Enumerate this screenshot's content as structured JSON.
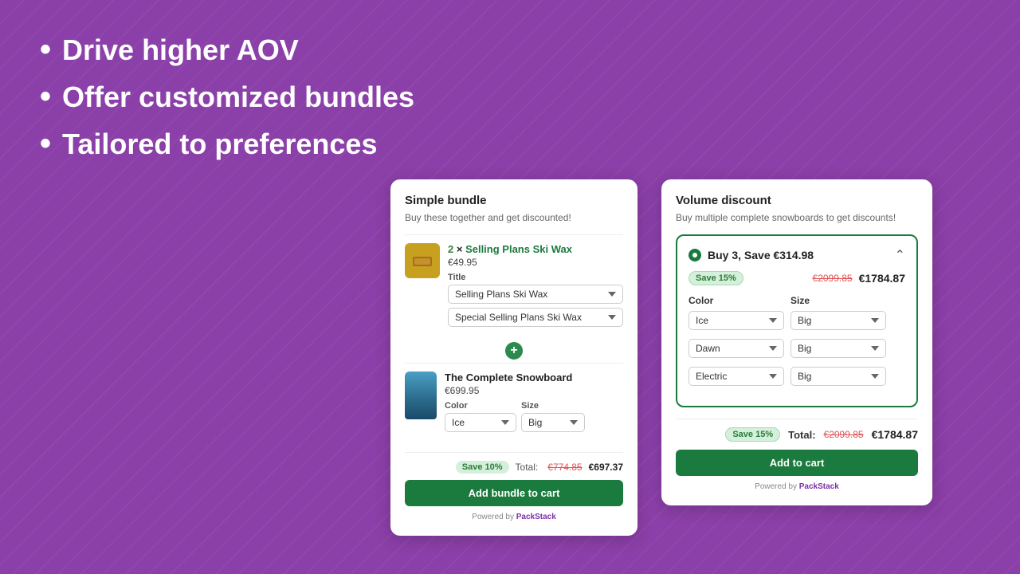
{
  "hero": {
    "bullets": [
      "Drive higher AOV",
      "Offer customized bundles",
      "Tailored to preferences"
    ]
  },
  "simple_bundle": {
    "title": "Simple bundle",
    "subtitle": "Buy these together and get discounted!",
    "product1": {
      "quantity": "2",
      "name": "Selling Plans Ski Wax",
      "price": "€49.95",
      "field_label": "Title",
      "select_options": [
        "Selling Plans Ski Wax",
        "Special Selling Plans Ski Wax"
      ],
      "select_value1": "Selling Plans Ski Wax",
      "select_value2": "Special Selling Plans Ski Wax"
    },
    "product2": {
      "name": "The Complete Snowboard",
      "price": "€699.95",
      "color_label": "Color",
      "size_label": "Size",
      "color_value": "Ice",
      "size_value": "Big"
    },
    "total_label": "Total:",
    "save_badge": "Save 10%",
    "price_old": "€774.85",
    "price_new": "€697.37",
    "add_cart_label": "Add bundle to cart",
    "powered_by": "Powered by",
    "powered_link": "PackStack"
  },
  "volume_discount": {
    "title": "Volume discount",
    "subtitle": "Buy multiple complete snowboards to get discounts!",
    "selected_option": {
      "label": "Buy 3, Save €314.98",
      "save_badge": "Save 15%",
      "price_old": "€2099.85",
      "price_new": "€1784.87"
    },
    "color_header": "Color",
    "size_header": "Size",
    "rows": [
      {
        "color": "Ice",
        "size": "Big"
      },
      {
        "color": "Dawn",
        "size": "Big"
      },
      {
        "color": "Electric",
        "size": "Big"
      }
    ],
    "total_label": "Total:",
    "save_badge": "Save 15%",
    "price_old": "€2099.85",
    "price_new": "€1784.87",
    "add_cart_label": "Add to cart",
    "powered_by": "Powered by",
    "powered_link": "PackStack"
  }
}
